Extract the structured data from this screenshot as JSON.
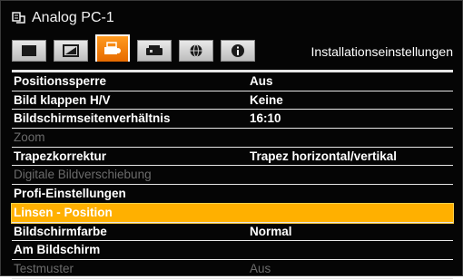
{
  "header": {
    "source_icon": "source-connector-icon",
    "source_title": "Analog PC-1",
    "menu_title": "Installationseinstellungen"
  },
  "tabs": [
    {
      "icon": "image-adjust-icon",
      "active": false
    },
    {
      "icon": "image-settings-icon",
      "active": false
    },
    {
      "icon": "installation-settings-icon",
      "active": true
    },
    {
      "icon": "system-settings-icon",
      "active": false
    },
    {
      "icon": "network-settings-icon",
      "active": false
    },
    {
      "icon": "information-icon",
      "active": false
    }
  ],
  "menu": {
    "items": [
      {
        "label": "Positionssperre",
        "value": "Aus",
        "state": "enabled"
      },
      {
        "label": "Bild klappen H/V",
        "value": "Keine",
        "state": "enabled"
      },
      {
        "label": "Bildschirmseitenverhältnis",
        "value": "16:10",
        "state": "enabled"
      },
      {
        "label": "Zoom",
        "value": "",
        "state": "disabled"
      },
      {
        "label": "Trapezkorrektur",
        "value": "Trapez horizontal/vertikal",
        "state": "enabled"
      },
      {
        "label": "Digitale Bildverschiebung",
        "value": "",
        "state": "disabled"
      },
      {
        "label": "Profi-Einstellungen",
        "value": "",
        "state": "enabled"
      },
      {
        "label": "Linsen - Position",
        "value": "",
        "state": "selected"
      },
      {
        "label": "Bildschirmfarbe",
        "value": "Normal",
        "state": "enabled"
      },
      {
        "label": "Am Bildschirm",
        "value": "",
        "state": "enabled"
      },
      {
        "label": "Testmuster",
        "value": "Aus",
        "state": "disabled"
      }
    ]
  },
  "colors": {
    "background": "#050505",
    "highlight": "#ffb000",
    "active_tab": "#ff8a00",
    "disabled_text": "#6b6b6b"
  }
}
